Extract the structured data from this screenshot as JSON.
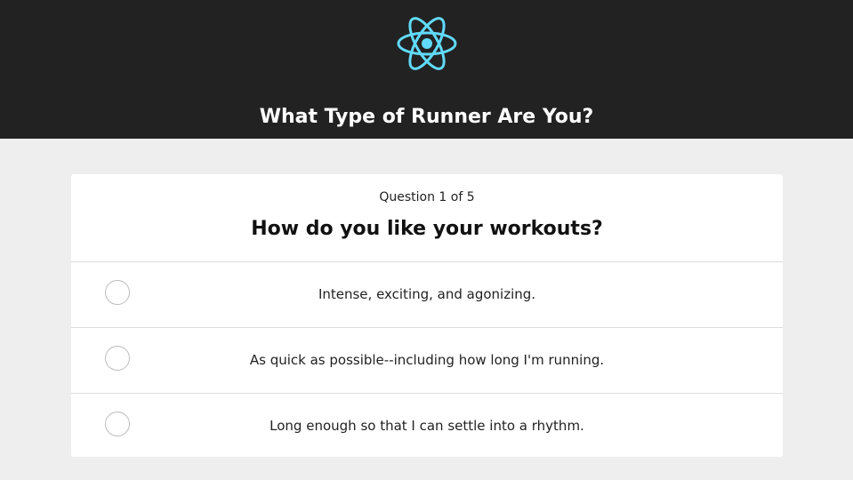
{
  "header": {
    "logo_icon": "react-atom-icon",
    "logo_color": "#61dafb",
    "title": "What Type of Runner Are You?"
  },
  "quiz": {
    "question_count": "Question 1 of 5",
    "question": "How do you like your workouts?",
    "answers": [
      {
        "label": "Intense, exciting, and agonizing."
      },
      {
        "label": "As quick as possible--including how long I'm running."
      },
      {
        "label": "Long enough so that I can settle into a rhythm."
      }
    ]
  },
  "colors": {
    "header_bg": "#222222",
    "page_bg": "#eeeeee",
    "card_bg": "#ffffff"
  }
}
